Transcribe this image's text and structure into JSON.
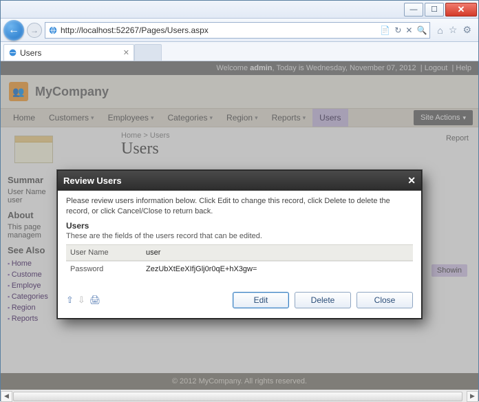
{
  "browser": {
    "url": "http://localhost:52267/Pages/Users.aspx",
    "tab_title": "Users",
    "refresh_glyph": "↻",
    "stop_glyph": "✕",
    "search_glyph": "🔍",
    "compat_glyph": "📄",
    "home_glyph": "⌂",
    "star_glyph": "☆",
    "gear_glyph": "⚙",
    "min_glyph": "—",
    "max_glyph": "☐",
    "close_glyph": "✕",
    "back_glyph": "←",
    "fwd_glyph": "→"
  },
  "page": {
    "welcome_prefix": "Welcome ",
    "welcome_user": "admin",
    "welcome_date": ", Today is Wednesday, November 07, 2012",
    "logout": "Logout",
    "help": "Help",
    "brand": "MyCompany",
    "menu": {
      "home": "Home",
      "customers": "Customers",
      "employees": "Employees",
      "categories": "Categories",
      "region": "Region",
      "reports": "Reports",
      "users": "Users",
      "site_actions": "Site Actions"
    },
    "breadcrumb_home": "Home",
    "breadcrumb_sep": ">",
    "breadcrumb_current": "Users",
    "title": "Users",
    "report_link": "Report",
    "showing": "Showin",
    "sidebar": {
      "summary_h": "Summar",
      "summary_l1": "User Name",
      "summary_l2": "user",
      "about_h": "About",
      "about_text": "This page\nmanagem",
      "seealso_h": "See Also",
      "items": [
        "Home",
        "Custome",
        "Employe",
        "Categories",
        "Region",
        "Reports"
      ]
    },
    "footer": "© 2012 MyCompany. All rights reserved."
  },
  "modal": {
    "title": "Review Users",
    "close_x": "✕",
    "intro": "Please review users information below. Click Edit to change this record, click Delete to delete the record, or click Cancel/Close to return back.",
    "section": "Users",
    "section_sub": "These are the fields of the users record that can be edited.",
    "fields": {
      "username_label": "User Name",
      "username_value": "user",
      "password_label": "Password",
      "password_value": "ZezUbXtEeXIfjGlj0r0qE+hX3gw="
    },
    "icons": {
      "up": "⇧",
      "down": "⇩",
      "print": "🖨"
    },
    "buttons": {
      "edit": "Edit",
      "delete": "Delete",
      "close": "Close"
    }
  }
}
